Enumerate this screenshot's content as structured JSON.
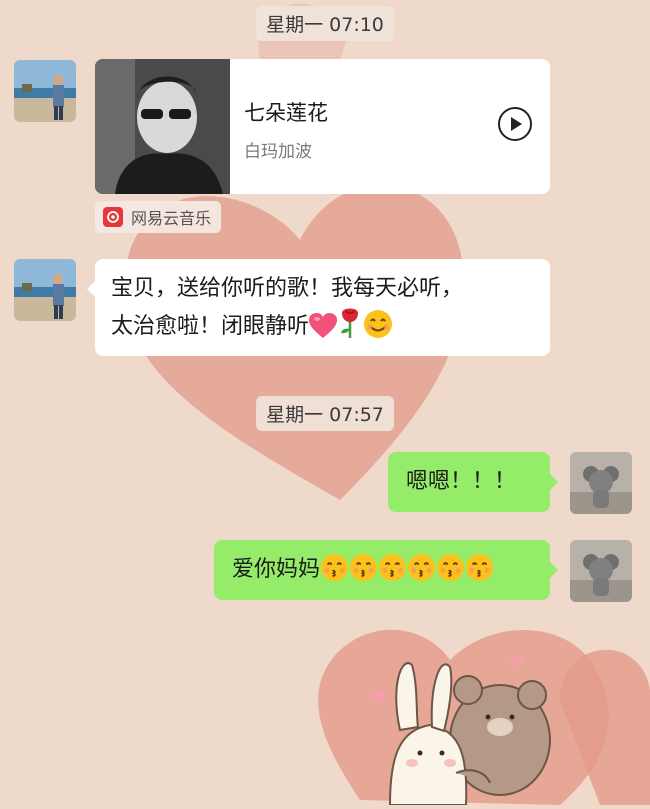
{
  "timestamps": [
    "星期一 07:10",
    "星期一 07:57"
  ],
  "music_card": {
    "title": "七朵莲花",
    "artist": "白玛加波",
    "source": "网易云音乐"
  },
  "messages": {
    "incoming_text": [
      "宝贝，送给你听的歌！我每天必听，",
      "太治愈啦！闭眼静听"
    ],
    "outgoing_1": "嗯嗯！！！",
    "outgoing_2": "爱你妈妈"
  },
  "icons": {
    "heart": "pink-heart-icon",
    "rose": "rose-icon",
    "smile": "smiling-face-icon",
    "kiss": "kissing-face-icon",
    "play": "play-icon",
    "source": "netease-music-logo-icon"
  },
  "colors": {
    "outgoing_bubble": "#95ec69",
    "incoming_bubble": "#ffffff",
    "chat_background": "#efd9cb",
    "heart_wallpaper": "#e59a8a"
  }
}
